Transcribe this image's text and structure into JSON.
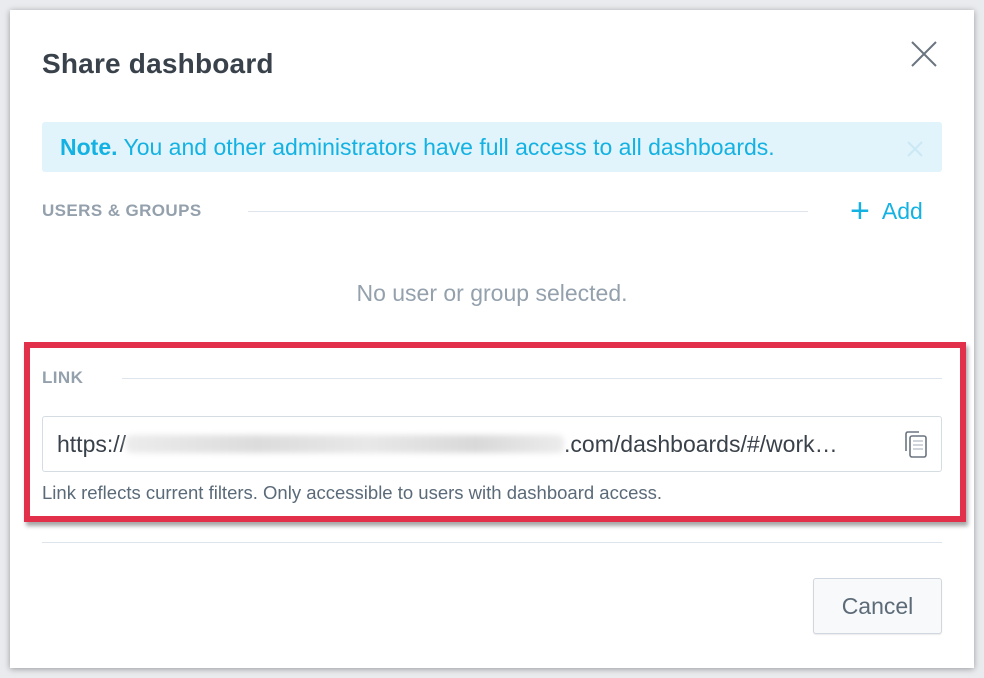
{
  "dialog": {
    "title": "Share dashboard"
  },
  "note": {
    "label": "Note.",
    "text": " You and other administrators have full access to all dashboards."
  },
  "users_groups": {
    "label": "USERS & GROUPS",
    "add_label": "Add",
    "empty_text": "No user or group selected."
  },
  "link": {
    "label": "LINK",
    "url_prefix": "https://",
    "url_suffix": ".com/dashboards/#/work…",
    "hint": "Link reflects current filters. Only accessible to users with dashboard access."
  },
  "footer": {
    "cancel_label": "Cancel"
  },
  "colors": {
    "accent": "#14b2e2",
    "note_bg": "#e1f3fb",
    "highlight": "#e2304b",
    "title": "#39414a",
    "muted": "#94a1ad"
  }
}
